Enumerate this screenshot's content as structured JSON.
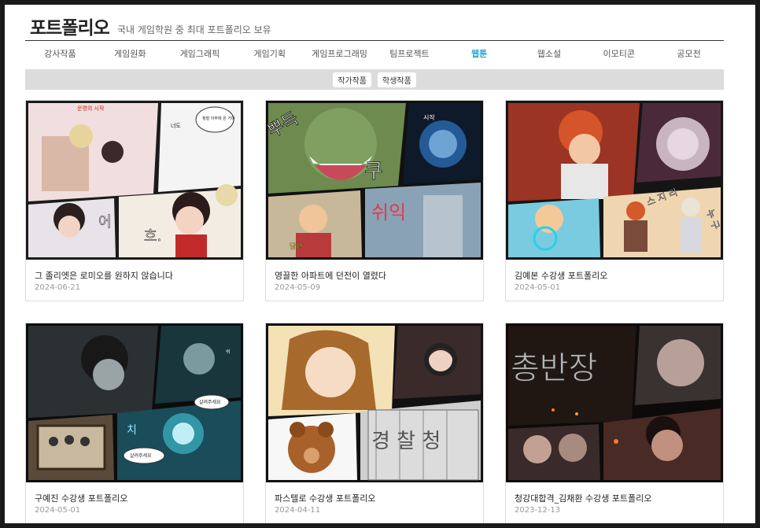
{
  "header": {
    "title": "포트폴리오",
    "subtitle": "국내 게임학원 중 최대 포트폴리오 보유"
  },
  "nav": {
    "items": [
      "강사작품",
      "게임원화",
      "게임그래픽",
      "게임기획",
      "게임프로그래밍",
      "팀프로젝트",
      "웹툰",
      "웹소설",
      "이모티콘",
      "공모전"
    ],
    "active_index": 6,
    "active_color": "#2aa7d6"
  },
  "subnav": {
    "items": [
      "작가작품",
      "학생작품"
    ]
  },
  "cards": [
    {
      "title": "그 졸리엣은 로미오를 원하지 않습니다",
      "date": "2024-06-21",
      "bubbles": [
        "운명의 시작",
        "정말 아무에 온 거야",
        "너도",
        "어",
        "흐."
      ]
    },
    {
      "title": "영끌한 아파트에 던전이 열렸다",
      "date": "2024-05-09",
      "bubbles": [
        "뿌득",
        "시작",
        "쿠",
        "쉬익",
        "당황"
      ]
    },
    {
      "title": "김예본 수강생 포트폴리오",
      "date": "2024-05-01",
      "bubbles": [
        "스 지 리",
        "누 구"
      ]
    },
    {
      "title": "구예진 수강생 포트폴리오",
      "date": "2024-05-01",
      "bubbles": [
        "살려주세요",
        "살려주세요",
        "치",
        "쉬"
      ]
    },
    {
      "title": "파스텔로 수강생 포트폴리오",
      "date": "2024-04-11",
      "bubbles": [
        "경 찰 청"
      ]
    },
    {
      "title": "청강대합격_김채환 수강생 포트폴리오",
      "date": "2023-12-13",
      "bubbles": [
        "총반장"
      ]
    }
  ]
}
